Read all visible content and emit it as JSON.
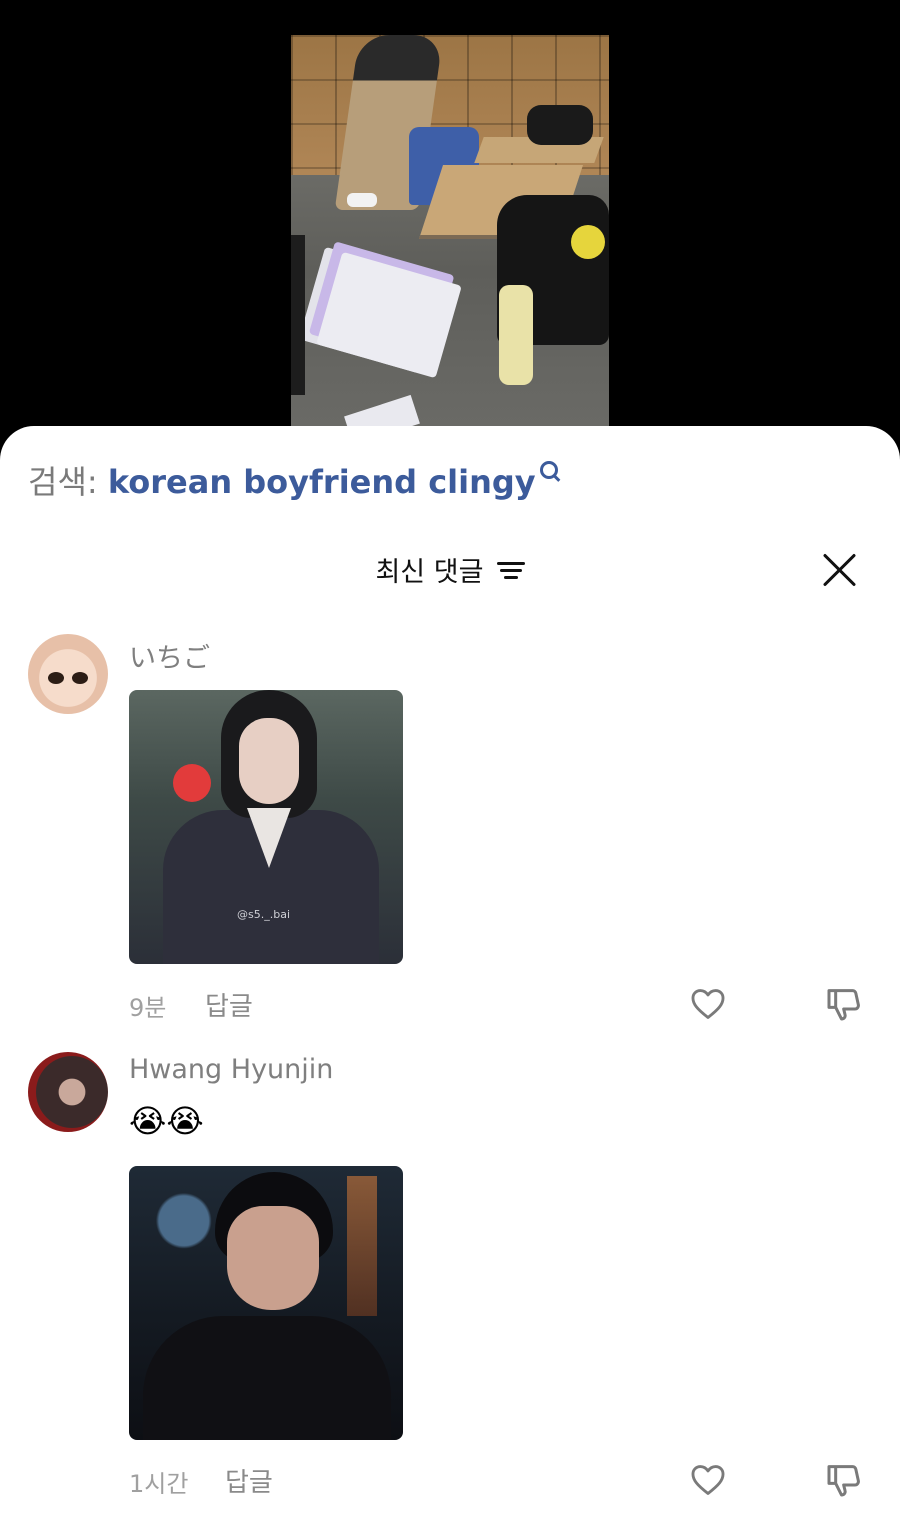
{
  "search": {
    "prefix": "검색:",
    "query": "korean boyfriend clingy"
  },
  "comments_header": {
    "sort_label": "최신 댓글"
  },
  "comments": [
    {
      "username": "いちご",
      "emoji": "",
      "media_watermark": "@s5._.bai",
      "time": "9분",
      "reply_label": "답글"
    },
    {
      "username": "Hwang Hyunjin",
      "emoji": "😭😭",
      "time": "1시간",
      "reply_label": "답글"
    }
  ],
  "icons": {
    "search": "search-icon",
    "filter": "filter-sort-icon",
    "close": "close-icon",
    "like": "heart-icon",
    "dislike": "thumbs-down-icon"
  },
  "colors": {
    "search_query": "#3c5b9b",
    "sheet_background": "#ffffff",
    "video_background": "#000000"
  }
}
